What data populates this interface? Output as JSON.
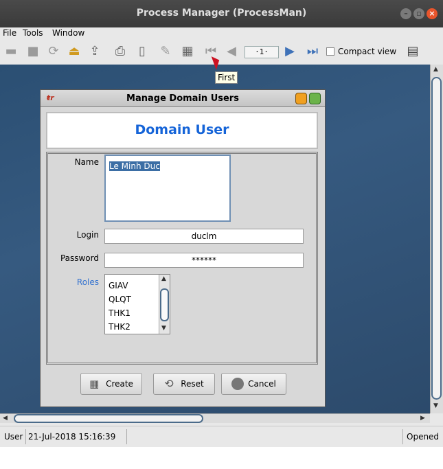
{
  "window": {
    "title": "Process Manager (ProcessMan)"
  },
  "menu": {
    "file": "File",
    "tools": "Tools",
    "window": "Window"
  },
  "toolbar": {
    "page_indicator": "·1·",
    "compact_view_label": "Compact view",
    "tooltip": "First"
  },
  "dialog": {
    "title": "Manage Domain Users",
    "header": "Domain User",
    "name_label": "Name",
    "name_value": "Le Minh Duc",
    "login_label": "Login",
    "login_value": "duclm",
    "password_label": "Password",
    "password_value": "******",
    "roles_label": "Roles",
    "roles": [
      "GIAV",
      "QLQT",
      "THK1",
      "THK2"
    ],
    "create_label": "Create",
    "reset_label": "Reset",
    "cancel_label": "Cancel"
  },
  "status": {
    "user": "User",
    "timestamp": "21-Jul-2018 15:16:39",
    "state": "Opened"
  }
}
